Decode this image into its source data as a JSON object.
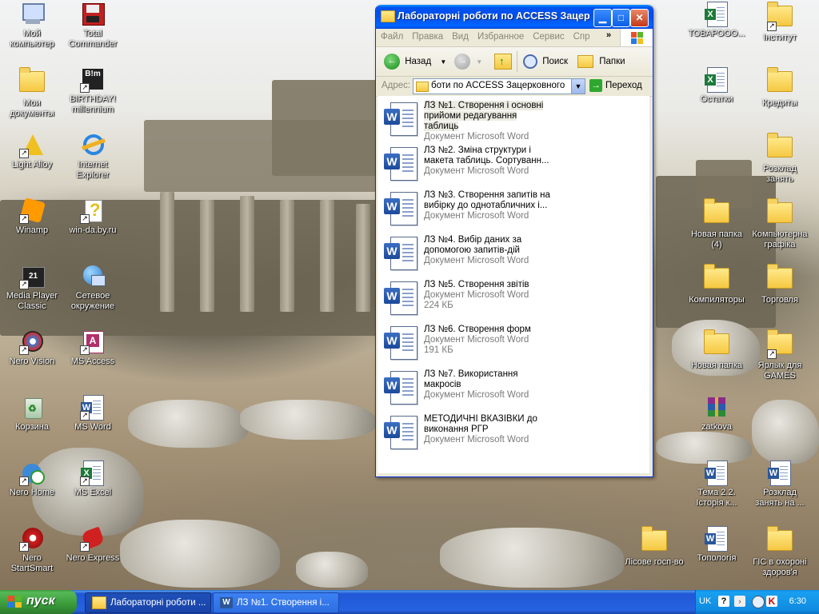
{
  "desktop": {
    "left_icons": [
      {
        "label": "Мой компьютер",
        "icon": "my-computer-icon"
      },
      {
        "label": "Мои документы",
        "icon": "my-documents-icon"
      },
      {
        "label": "Light Alloy",
        "icon": "light-alloy-icon"
      },
      {
        "label": "Winamp",
        "icon": "winamp-icon"
      },
      {
        "label": "Media Player Classic",
        "icon": "media-player-classic-icon"
      },
      {
        "label": "Nero Vision",
        "icon": "nero-vision-icon"
      },
      {
        "label": "Корзина",
        "icon": "recycle-bin-icon"
      },
      {
        "label": "Nero Home",
        "icon": "nero-home-icon"
      },
      {
        "label": "Nero StartSmart",
        "icon": "nero-startsmart-icon"
      }
    ],
    "second_column_icons": [
      {
        "label": "Total Commander",
        "icon": "total-commander-icon"
      },
      {
        "label": "BIRTHDAY! millennium",
        "icon": "birthday-millennium-icon"
      },
      {
        "label": "Internet Explorer",
        "icon": "internet-explorer-icon"
      },
      {
        "label": "win-da.by.ru",
        "icon": "help-file-icon"
      },
      {
        "label": "Сетевое окружение",
        "icon": "network-places-icon"
      },
      {
        "label": "MS Access",
        "icon": "ms-access-icon"
      },
      {
        "label": "MS Word",
        "icon": "ms-word-icon"
      },
      {
        "label": "MS Excel",
        "icon": "ms-excel-icon"
      },
      {
        "label": "Nero Express",
        "icon": "nero-express-icon"
      }
    ],
    "right_icons": [
      {
        "label": "ТОВАРООО...",
        "icon": "excel-doc-icon"
      },
      {
        "label": "Інститут",
        "icon": "folder-icon"
      },
      {
        "label": "Остатки",
        "icon": "excel-doc-icon"
      },
      {
        "label": "Кредиты",
        "icon": "folder-icon"
      },
      {
        "label": "Розклад занять",
        "icon": "folder-icon"
      },
      {
        "label": "Новая папка (4)",
        "icon": "folder-icon"
      },
      {
        "label": "Компьютерна графіка",
        "icon": "folder-icon"
      },
      {
        "label": "Компиляторы",
        "icon": "folder-icon"
      },
      {
        "label": "Торговля",
        "icon": "folder-icon"
      },
      {
        "label": "Новая папка",
        "icon": "folder-icon"
      },
      {
        "label": "Ярлык для GAMES",
        "icon": "folder-shortcut-icon"
      },
      {
        "label": "zatkova",
        "icon": "winrar-archive-icon"
      },
      {
        "label": "Тема 2.2. Історія к...",
        "icon": "word-doc-icon"
      },
      {
        "label": "Розклад занять на ...",
        "icon": "word-doc-icon"
      },
      {
        "label": "Лісове госп-во",
        "icon": "folder-icon"
      },
      {
        "label": "Топологія",
        "icon": "word-doc-icon"
      },
      {
        "label": "ГІС в охороні здоров'я",
        "icon": "folder-icon"
      }
    ]
  },
  "window": {
    "title": "Лабораторні роботи по ACCESS Зацерковного В.І",
    "menu": [
      "Файл",
      "Правка",
      "Вид",
      "Избранное",
      "Сервис",
      "Спр"
    ],
    "toolbar": {
      "back": "Назад",
      "search": "Поиск",
      "folders": "Папки"
    },
    "address": {
      "label": "Адрес:",
      "value": "боти по ACCESS Зацерковного В.І",
      "go": "Переход"
    },
    "files": [
      {
        "name": "ЛЗ №1. Створення і основні прийоми редагування таблиць",
        "type": "Документ Microsoft Word",
        "size": ""
      },
      {
        "name": "ЛЗ №2. Зміна структури і макета таблиць. Сортуванн...",
        "type": "Документ Microsoft Word",
        "size": ""
      },
      {
        "name": "ЛЗ №3. Створення запитів на вибірку до однотабличних і...",
        "type": "Документ Microsoft Word",
        "size": ""
      },
      {
        "name": "ЛЗ №4. Вибір даних за допомогою запитів-дій",
        "type": "Документ Microsoft Word",
        "size": ""
      },
      {
        "name": "ЛЗ №5. Створення звітів",
        "type": "Документ Microsoft Word",
        "size": "224 КБ"
      },
      {
        "name": "ЛЗ №6. Створення форм",
        "type": "Документ Microsoft Word",
        "size": "191 КБ"
      },
      {
        "name": "ЛЗ №7. Використання макросів",
        "type": "Документ Microsoft Word",
        "size": ""
      },
      {
        "name": "МЕТОДИЧНІ ВКАЗІВКИ до виконання РГР",
        "type": "Документ Microsoft Word",
        "size": ""
      }
    ]
  },
  "taskbar": {
    "start_label": "пуск",
    "tasks": [
      "Лабораторні роботи ...",
      "ЛЗ №1. Створення і..."
    ],
    "language": "UK",
    "clock": "6:30"
  }
}
